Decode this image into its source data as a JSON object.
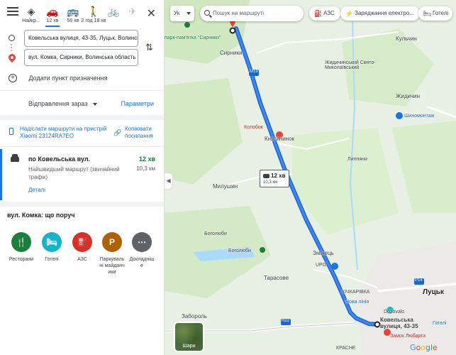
{
  "travel_modes": [
    {
      "icon": "diamond-directions-icon",
      "label": "Найкр..."
    },
    {
      "icon": "car-icon",
      "label": "12 хв"
    },
    {
      "icon": "bus-icon",
      "label": "56 хв"
    },
    {
      "icon": "walk-icon",
      "label": "2 год 18 хв"
    },
    {
      "icon": "bike-icon",
      "label": ""
    },
    {
      "icon": "plane-icon",
      "label": ""
    }
  ],
  "waypoints": {
    "origin": "Ковельська вулиця, 43-35, Луцьк, Волинська область",
    "destination": "вул. Комка, Сирники, Волинська область"
  },
  "add_destination": "Додати пункт призначення",
  "departure": {
    "label": "Відправлення зараз",
    "options_label": "Параметри"
  },
  "actions": {
    "send_to_device": "Надіслати маршрути на пристрій Xiaomi 23124RA7EO",
    "copy_link": "Копіювати посилання"
  },
  "route": {
    "name": "по Ковельська вул.",
    "time": "12 хв",
    "description": "Найшвидший маршрут (звичайний трафік)",
    "distance": "10,3 км",
    "details_label": "Деталі"
  },
  "nearby": {
    "title": "вул. Комка: що поруч",
    "categories": [
      {
        "icon": "restaurant-icon",
        "glyph": "🍴",
        "label": "Ресторани",
        "color": "#188038"
      },
      {
        "icon": "hotel-icon",
        "glyph": "🛏",
        "label": "Готелі",
        "color": "#12b5cb"
      },
      {
        "icon": "gas-station-icon",
        "glyph": "⛽",
        "label": "АЗС",
        "color": "#d93025"
      },
      {
        "icon": "parking-icon",
        "glyph": "P",
        "label": "Паркувальні майданчики",
        "color": "#b06000"
      },
      {
        "icon": "more-icon",
        "glyph": "⋯",
        "label": "Докладніше",
        "color": "#5f6368"
      }
    ]
  },
  "map": {
    "language": "Ук",
    "search_placeholder": "Пошук на маршруті",
    "chips": [
      {
        "icon": "gas-station-icon",
        "glyph": "⛽",
        "label": "АЗС"
      },
      {
        "icon": "charging-icon",
        "glyph": "⚡",
        "label": "Заряджання електро..."
      },
      {
        "icon": "hotel-icon",
        "glyph": "🛏",
        "label": "Готелі"
      }
    ],
    "route_bubble": {
      "time": "12 хв",
      "distance": "10,3 км"
    },
    "layers_label": "Шари",
    "attribution": "Google",
    "labels": {
      "sirnyky": "Сирники",
      "sirnyky_park": "парк-пам'ятка \"Сирники\"",
      "kulchyn": "Кульчин",
      "church": "Жидичинський Свято-Миколаївський",
      "zhydychyn": "Жидичин",
      "shynomontazh": "Шиномонтаж",
      "kolobok": "Колобок",
      "knyahynynok": "Княгининок",
      "lypliany": "Липляни",
      "milushyn": "Милушин",
      "boholiuby": "Боголюби",
      "boholiuby_2": "Боголюби",
      "zmiinets": "Змінець",
      "upg": "UPG",
      "tarasove": "Тарасове",
      "kichkarivka": "КІЧКАРІВКА",
      "nova_liniia": "Нова лінія",
      "dozovalo": "Dozovalo",
      "zaborol": "Забороль",
      "lutsk": "Луцьк",
      "dest_address": "Ковельська вулиця, 43-35",
      "castle": "Замок Любарта",
      "krasne": "КРАСНЕ",
      "road_m19": "М19",
      "road_h22": "Н22",
      "road_p14": "Р14",
      "hotels_label": "Готелі"
    }
  }
}
